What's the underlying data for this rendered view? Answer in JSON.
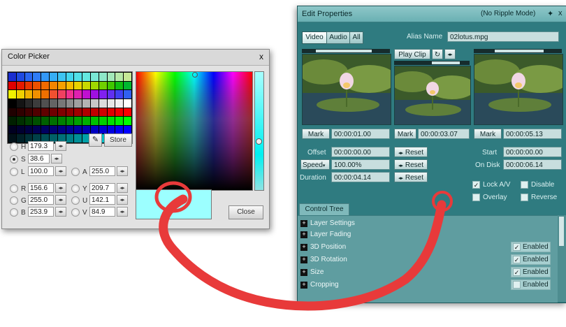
{
  "color_picker": {
    "title": "Color Picker",
    "close_x": "x",
    "store_label": "Store",
    "close_label": "Close",
    "swatch_colors": [
      "#1a2ed0",
      "#1f4ae0",
      "#2a66f0",
      "#2f7cf7",
      "#3398f7",
      "#36aef5",
      "#3ec4f2",
      "#44d6ee",
      "#52e0e8",
      "#64e8e0",
      "#7ae8d5",
      "#8ee8c8",
      "#a3e8b9",
      "#b6e8a8",
      "#c6e896",
      "#e00000",
      "#e61a00",
      "#ea3500",
      "#ee5000",
      "#f06a00",
      "#f28500",
      "#f4a000",
      "#f6bb00",
      "#e8d200",
      "#c8d800",
      "#a0d800",
      "#70d000",
      "#40c800",
      "#10c010",
      "#00b830",
      "#f0f000",
      "#f0d000",
      "#f0b000",
      "#f09000",
      "#f07000",
      "#f05030",
      "#f04060",
      "#f03090",
      "#e020b0",
      "#c010d0",
      "#a010e0",
      "#8020f0",
      "#6030f0",
      "#4040f0",
      "#3060f0",
      "#000000",
      "#141414",
      "#282828",
      "#3c3c3c",
      "#505050",
      "#646464",
      "#787878",
      "#8c8c8c",
      "#a0a0a0",
      "#b4b4b4",
      "#c8c8c8",
      "#dcdcdc",
      "#e6e6e6",
      "#f0f0f0",
      "#ffffff",
      "#200000",
      "#300000",
      "#400000",
      "#500000",
      "#600000",
      "#700000",
      "#800000",
      "#900000",
      "#a00000",
      "#b00000",
      "#c00000",
      "#d00000",
      "#e00000",
      "#f00000",
      "#ff0000",
      "#002000",
      "#003000",
      "#004000",
      "#005000",
      "#006000",
      "#007000",
      "#008000",
      "#009000",
      "#00a000",
      "#00b000",
      "#00c000",
      "#00d000",
      "#00e000",
      "#00f000",
      "#00ff00",
      "#000020",
      "#000030",
      "#000040",
      "#000050",
      "#000060",
      "#000070",
      "#000080",
      "#000090",
      "#0000a0",
      "#0000b0",
      "#0000c0",
      "#0000d0",
      "#0000e0",
      "#0000f0",
      "#0000ff",
      "#001018",
      "#002028",
      "#003038",
      "#004048",
      "#005058",
      "#006068",
      "#007078",
      "#008088",
      "#009098",
      "#00a0a8",
      "#00b0b8",
      "#00c0c8",
      "#00d0d8",
      "#00e0e8",
      "#00f0f8"
    ],
    "preview_color": "#9cffff",
    "fields": {
      "h": {
        "label": "H",
        "value": "179.3"
      },
      "s": {
        "label": "S",
        "value": "38.6"
      },
      "l": {
        "label": "L",
        "value": "100.0"
      },
      "a": {
        "label": "A",
        "value": "255.0"
      },
      "r": {
        "label": "R",
        "value": "156.6"
      },
      "y": {
        "label": "Y",
        "value": "209.7"
      },
      "g": {
        "label": "G",
        "value": "255.0"
      },
      "u": {
        "label": "U",
        "value": "142.1"
      },
      "b": {
        "label": "B",
        "value": "253.9"
      },
      "v": {
        "label": "V",
        "value": "84.9"
      }
    },
    "spin_glyph": "◂▸",
    "selected_radio": "S"
  },
  "edit_properties": {
    "title": "Edit Properties",
    "mode": "(No Ripple Mode)",
    "pin_glyph": "✦",
    "close_x": "x",
    "tabs": [
      "Video",
      "Audio",
      "All"
    ],
    "active_tab": "Video",
    "alias_label": "Alias Name",
    "alias_value": "02lotus.mpg",
    "play_clip_label": "Play Clip",
    "loop_glyph": "↻",
    "step_glyph": "◂▸",
    "mark_label": "Mark",
    "marks": [
      "00:00:01.00",
      "00:00:03.07",
      "00:00:05.13"
    ],
    "offset_label": "Offset",
    "offset_value": "00:00:00.00",
    "speed_label": "Speed",
    "speed_value": "100.00%",
    "duration_label": "Duration",
    "duration_value": "00:00:04.14",
    "reset_label": "Reset",
    "start_label": "Start",
    "start_value": "00:00:00.00",
    "ondisk_label": "On Disk",
    "ondisk_value": "00:00:06.14",
    "lock_av_label": "Lock A/V",
    "lock_av_checked": true,
    "disable_label": "Disable",
    "disable_checked": false,
    "overlay_label": "Overlay",
    "overlay_checked": false,
    "reverse_label": "Reverse",
    "reverse_checked": false,
    "control_tree_label": "Control Tree",
    "tree_items": [
      {
        "label": "Layer Settings",
        "enabled_shown": false
      },
      {
        "label": "Layer Fading",
        "enabled_shown": false
      },
      {
        "label": "3D Position",
        "enabled_shown": true,
        "enabled_checked": true
      },
      {
        "label": "3D Rotation",
        "enabled_shown": true,
        "enabled_checked": true
      },
      {
        "label": "Size",
        "enabled_shown": true,
        "enabled_checked": true
      },
      {
        "label": "Cropping",
        "enabled_shown": true,
        "enabled_checked": false
      }
    ],
    "enabled_label": "Enabled",
    "plus_glyph": "+"
  },
  "annotation": {
    "color": "#e83a3a"
  }
}
